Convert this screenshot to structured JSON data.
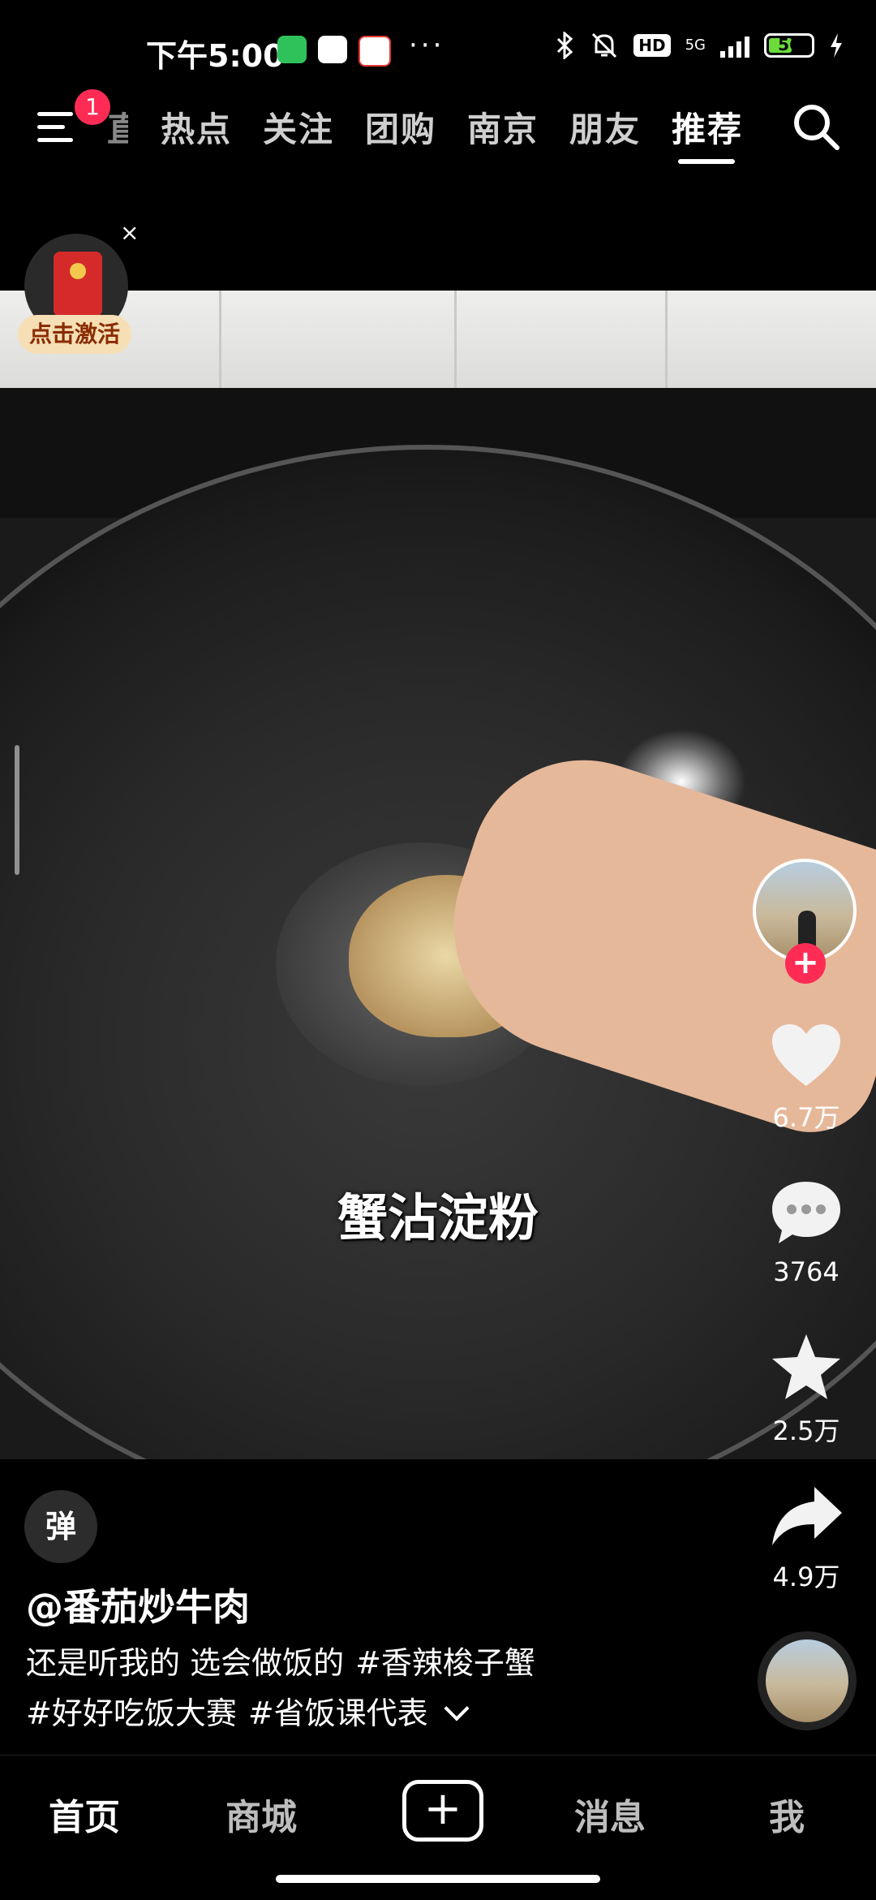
{
  "status_bar": {
    "time": "下午5:00",
    "app_icons": [
      "green-app-icon",
      "cloud-app-icon",
      "58-app-icon"
    ],
    "more": "···",
    "hd": "HD",
    "network": "5G",
    "battery": "56",
    "battery_level": 0.56
  },
  "top_nav": {
    "badge_count": "1",
    "partial_tab": "直",
    "tabs": [
      "热点",
      "关注",
      "团购",
      "南京",
      "朋友",
      "推荐"
    ],
    "active_tab": "推荐"
  },
  "red_packet": {
    "label": "点击激活",
    "close": "×"
  },
  "video": {
    "subtitle": "蟹沾淀粉"
  },
  "actions": {
    "likes": "6.7万",
    "comments": "3764",
    "favorites": "2.5万",
    "shares": "4.9万",
    "follow": "+"
  },
  "post": {
    "danmu": "弹",
    "author": "@番茄炒牛肉",
    "caption_text": "还是听我的 选会做饭的",
    "hashtags": [
      "#香辣梭子蟹",
      "#好好吃饭大赛",
      "#省饭课代表"
    ]
  },
  "tab_bar": {
    "tabs": [
      "首页",
      "商城",
      "消息",
      "我"
    ],
    "add": "+"
  }
}
